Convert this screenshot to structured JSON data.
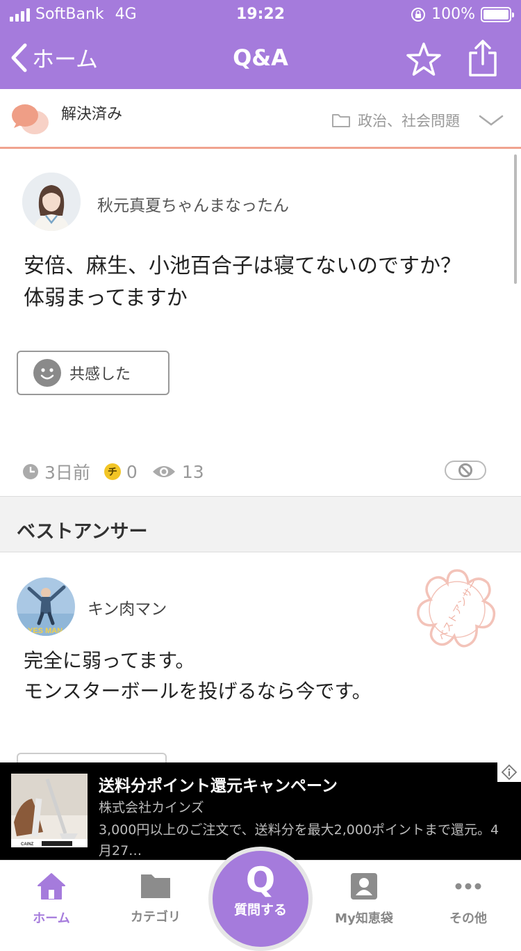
{
  "status_bar": {
    "carrier": "SoftBank",
    "network": "4G",
    "time": "19:22",
    "battery": "100%"
  },
  "nav": {
    "back_label": "ホーム",
    "title": "Q&A",
    "star_icon": "star-icon",
    "share_icon": "share-icon"
  },
  "category_bar": {
    "status": "解決済み",
    "category": "政治、社会問題"
  },
  "question": {
    "user": "秋元真夏ちゃんまなったん",
    "text_line1": "安倍、麻生、小池百合子は寝てないのですか？",
    "text_line2": "体弱まってますか",
    "empathy_label": "共感した",
    "posted": "3日前",
    "coin_symbol": "チ",
    "coins": "0",
    "views": "13"
  },
  "best_answer": {
    "header": "ベストアンサー",
    "user": "キン肉マン",
    "avatar_text": "YES MAN",
    "stamp_text": "ベストアンサー",
    "text_line1": "完全に弱ってます。",
    "text_line2": "モンスターボールを投げるなら今です。"
  },
  "ad": {
    "title": "送料分ポイント還元キャンペーン",
    "company": "株式会社カインズ",
    "description": "3,000円以上のご注文で、送料分を最大2,000ポイントまで還元。4月27…",
    "logo_text": "CAINZ"
  },
  "tabs": [
    {
      "label": "ホーム",
      "icon": "home-icon",
      "active": true
    },
    {
      "label": "カテゴリ",
      "icon": "folder-icon",
      "active": false
    },
    {
      "label": "質問する",
      "icon": "q-icon",
      "active": false
    },
    {
      "label": "My知恵袋",
      "icon": "profile-icon",
      "active": false
    },
    {
      "label": "その他",
      "icon": "more-icon",
      "active": false
    }
  ],
  "ask_symbol": "Q",
  "colors": {
    "brand": "#a57bdc",
    "accent_line": "#f0a38f",
    "ad_bg": "#000000",
    "stamp": "#f3c3b9"
  }
}
